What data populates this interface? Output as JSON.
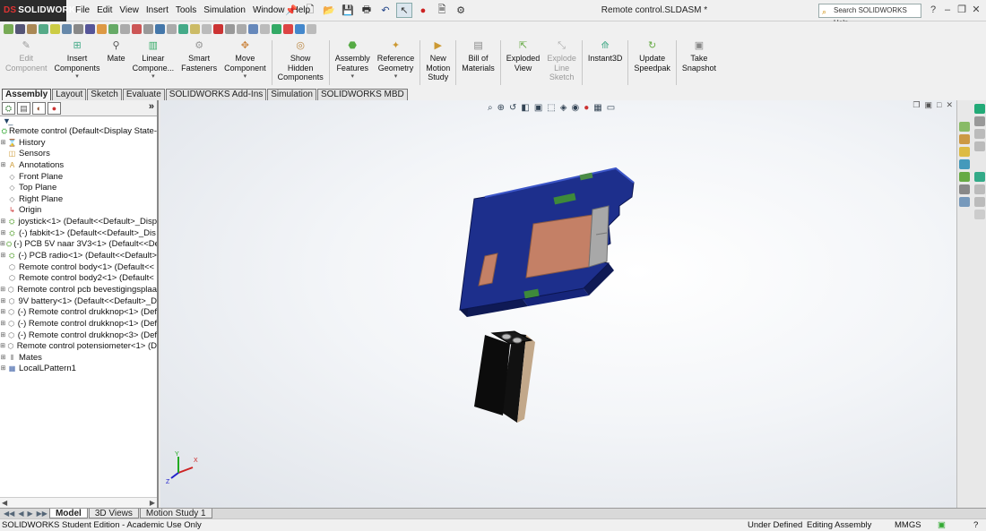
{
  "app": {
    "logo_text": "SOLIDWORKS",
    "doc_title": "Remote control.SLDASM *",
    "menus": [
      "File",
      "Edit",
      "View",
      "Insert",
      "Tools",
      "Simulation",
      "Window",
      "Help"
    ],
    "search_placeholder": "Search SOLIDWORKS Help"
  },
  "commands": [
    {
      "label": "Edit\nComponent",
      "disabled": true,
      "icon": "edit-component-icon"
    },
    {
      "label": "Insert\nComponents",
      "disabled": false,
      "icon": "insert-components-icon",
      "dropdown": true
    },
    {
      "label": "Mate",
      "disabled": false,
      "icon": "mate-icon"
    },
    {
      "label": "Linear\nCompone...",
      "disabled": false,
      "icon": "linear-pattern-icon",
      "dropdown": true
    },
    {
      "label": "Smart\nFasteners",
      "disabled": false,
      "icon": "smart-fasteners-icon"
    },
    {
      "label": "Move\nComponent",
      "disabled": false,
      "icon": "move-component-icon",
      "dropdown": true
    },
    {
      "label": "Show\nHidden\nComponents",
      "disabled": false,
      "icon": "show-hidden-icon"
    },
    {
      "label": "Assembly\nFeatures",
      "disabled": false,
      "icon": "assembly-features-icon",
      "dropdown": true
    },
    {
      "label": "Reference\nGeometry",
      "disabled": false,
      "icon": "reference-geometry-icon",
      "dropdown": true
    },
    {
      "label": "New\nMotion\nStudy",
      "disabled": false,
      "icon": "new-motion-study-icon"
    },
    {
      "label": "Bill of\nMaterials",
      "disabled": false,
      "icon": "bill-of-materials-icon"
    },
    {
      "label": "Exploded\nView",
      "disabled": false,
      "icon": "exploded-view-icon"
    },
    {
      "label": "Explode\nLine\nSketch",
      "disabled": true,
      "icon": "explode-line-sketch-icon"
    },
    {
      "label": "Instant3D",
      "disabled": false,
      "icon": "instant3d-icon"
    },
    {
      "label": "Update\nSpeedpak",
      "disabled": false,
      "icon": "update-speedpak-icon"
    },
    {
      "label": "Take\nSnapshot",
      "disabled": false,
      "icon": "take-snapshot-icon"
    }
  ],
  "cmd_tabs": [
    "Assembly",
    "Layout",
    "Sketch",
    "Evaluate",
    "SOLIDWORKS Add-Ins",
    "Simulation",
    "SOLIDWORKS MBD"
  ],
  "active_cmd_tab": "Assembly",
  "tree": [
    {
      "label": "Remote control  (Default<Display State-",
      "icon": "assembly-icon",
      "expand": ""
    },
    {
      "label": "History",
      "icon": "history-icon",
      "expand": "+"
    },
    {
      "label": "Sensors",
      "icon": "sensors-icon",
      "expand": ""
    },
    {
      "label": "Annotations",
      "icon": "annotations-icon",
      "expand": "+"
    },
    {
      "label": "Front Plane",
      "icon": "plane-icon",
      "expand": ""
    },
    {
      "label": "Top Plane",
      "icon": "plane-icon",
      "expand": ""
    },
    {
      "label": "Right Plane",
      "icon": "plane-icon",
      "expand": ""
    },
    {
      "label": "Origin",
      "icon": "origin-icon",
      "expand": ""
    },
    {
      "label": "joystick<1> (Default<<Default>_Disp",
      "icon": "subassembly-icon",
      "expand": "+"
    },
    {
      "label": "(-) fabkit<1> (Default<<Default>_Dis",
      "icon": "subassembly-icon",
      "expand": "+"
    },
    {
      "label": "(-) PCB 5V naar 3V3<1> (Default<<De",
      "icon": "subassembly-icon",
      "expand": "+"
    },
    {
      "label": "(-) PCB radio<1> (Default<<Default>",
      "icon": "subassembly-icon",
      "expand": "+"
    },
    {
      "label": "Remote control body<1> (Default<<",
      "icon": "part-icon",
      "expand": ""
    },
    {
      "label": "Remote control body2<1> (Default<",
      "icon": "part-icon",
      "expand": ""
    },
    {
      "label": "Remote control pcb bevestigingsplaa",
      "icon": "part-icon",
      "expand": "+"
    },
    {
      "label": "9V battery<1> (Default<<Default>_D",
      "icon": "part-icon",
      "expand": "+"
    },
    {
      "label": "(-) Remote control drukknop<1> (Def",
      "icon": "part-icon",
      "expand": "+"
    },
    {
      "label": "(-) Remote control drukknop<1> (Def",
      "icon": "part-icon",
      "expand": "+"
    },
    {
      "label": "(-) Remote control drukknop<3> (Def",
      "icon": "part-icon",
      "expand": "+"
    },
    {
      "label": "Remote control potensiometer<1> (D",
      "icon": "part-icon",
      "expand": "+"
    },
    {
      "label": "Mates",
      "icon": "mates-icon",
      "expand": "+"
    },
    {
      "label": "LocalLPattern1",
      "icon": "pattern-icon",
      "expand": "+"
    }
  ],
  "bottom_tabs": [
    "Model",
    "3D Views",
    "Motion Study 1"
  ],
  "active_bottom_tab": "Model",
  "status": {
    "edition": "SOLIDWORKS Student Edition - Academic Use Only",
    "definition": "Under Defined",
    "mode": "Editing Assembly",
    "units": "MMGS"
  },
  "colors": {
    "enclosure": "#1d2f8c",
    "pcb_copper": "#c48066",
    "battery_body": "#111111",
    "battery_label": "#c2a88a",
    "accent_green": "#3e8a3a"
  }
}
